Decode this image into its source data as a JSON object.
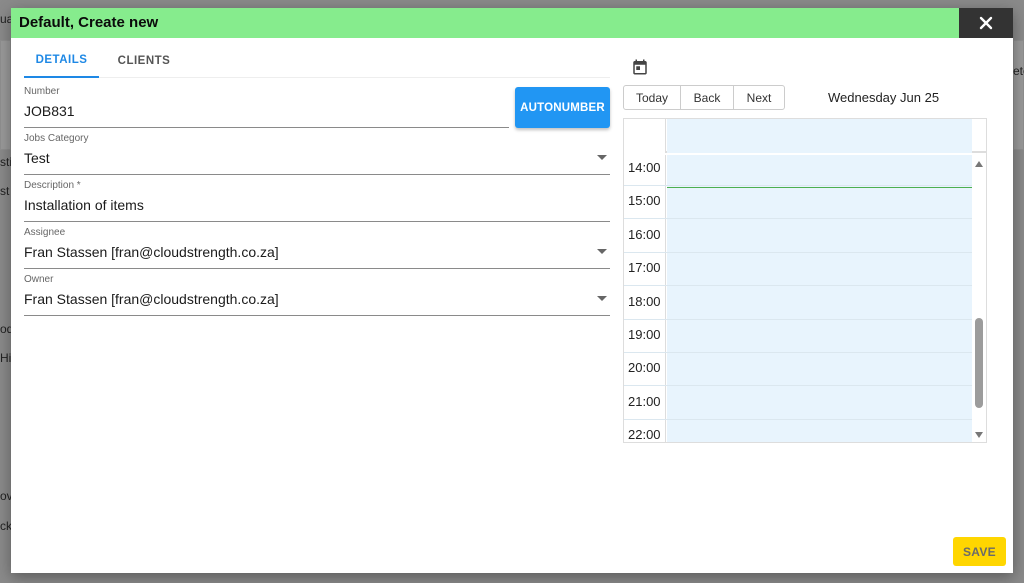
{
  "dialog": {
    "title": "Default, Create new"
  },
  "tabs": [
    {
      "label": "DETAILS",
      "active": true
    },
    {
      "label": "CLIENTS",
      "active": false
    }
  ],
  "form": {
    "number": {
      "label": "Number",
      "value": "JOB831"
    },
    "category": {
      "label": "Jobs Category",
      "value": "Test"
    },
    "description": {
      "label": "Description *",
      "value": "Installation of items"
    },
    "assignee": {
      "label": "Assignee",
      "value": "Fran Stassen [fran@cloudstrength.co.za]"
    },
    "owner": {
      "label": "Owner",
      "value": "Fran Stassen [fran@cloudstrength.co.za]"
    },
    "autonumber_label": "AUTONUMBER"
  },
  "calendar": {
    "today_label": "Today",
    "back_label": "Back",
    "next_label": "Next",
    "date_label": "Wednesday Jun 25",
    "times": [
      "14:00",
      "15:00",
      "16:00",
      "17:00",
      "18:00",
      "19:00",
      "20:00",
      "21:00",
      "22:00"
    ]
  },
  "save_label": "SAVE",
  "background": {
    "fragments": [
      "ua",
      "sti",
      "st",
      "od",
      "Hi",
      "ov",
      "ck",
      "ete"
    ]
  },
  "colors": {
    "titlebar": "#86ec8d",
    "primary": "#2196f3",
    "save": "#ffd600",
    "now_line": "#4caf50"
  }
}
